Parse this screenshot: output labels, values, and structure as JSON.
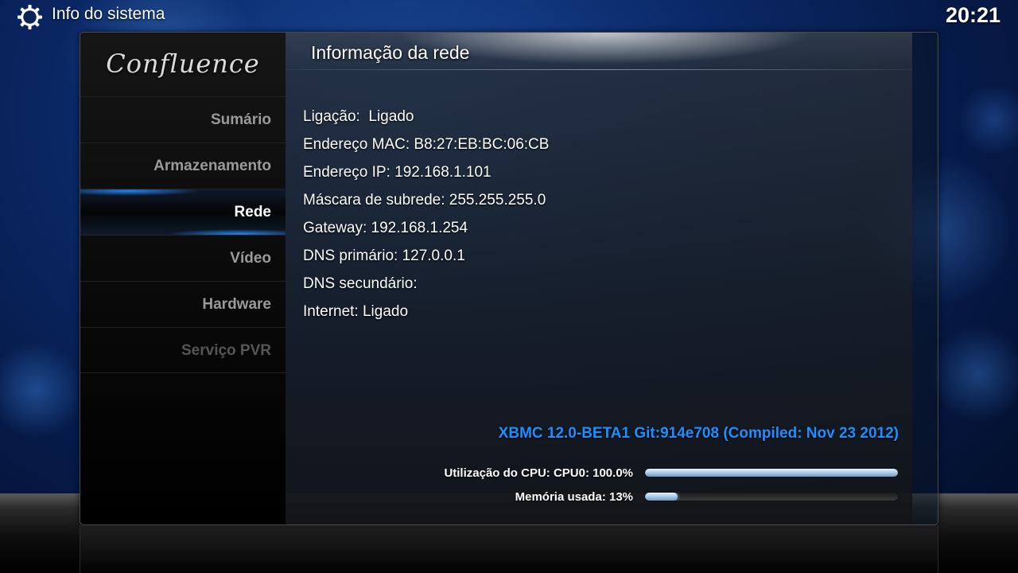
{
  "topbar": {
    "title": "Info do sistema",
    "icon": "gear-icon",
    "clock": "20:21"
  },
  "sidebar": {
    "logo": "Confluence",
    "items": [
      {
        "label": "Sumário",
        "state": "normal"
      },
      {
        "label": "Armazenamento",
        "state": "normal"
      },
      {
        "label": "Rede",
        "state": "active"
      },
      {
        "label": "Vídeo",
        "state": "normal"
      },
      {
        "label": "Hardware",
        "state": "normal"
      },
      {
        "label": "Serviço PVR",
        "state": "disabled"
      }
    ]
  },
  "main": {
    "title": "Informação da rede",
    "info": [
      "Ligação:  Ligado",
      "Endereço MAC: B8:27:EB:BC:06:CB",
      "Endereço IP: 192.168.1.101",
      "Máscara de subrede: 255.255.255.0",
      "Gateway: 192.168.1.254",
      "DNS primário: 127.0.0.1",
      "DNS secundário:",
      "Internet: Ligado"
    ],
    "version": "XBMC 12.0-BETA1 Git:914e708 (Compiled: Nov 23 2012)",
    "stats": [
      {
        "label": "Utilização do CPU: CPU0: 100.0%",
        "fraction": 1.0
      },
      {
        "label": "Memória usada: 13%",
        "fraction": 0.13
      }
    ]
  },
  "colors": {
    "accent": "#1e8fff",
    "text": "#ffffff",
    "menu_inactive": "#9a9a9a",
    "menu_disabled": "#555555"
  }
}
